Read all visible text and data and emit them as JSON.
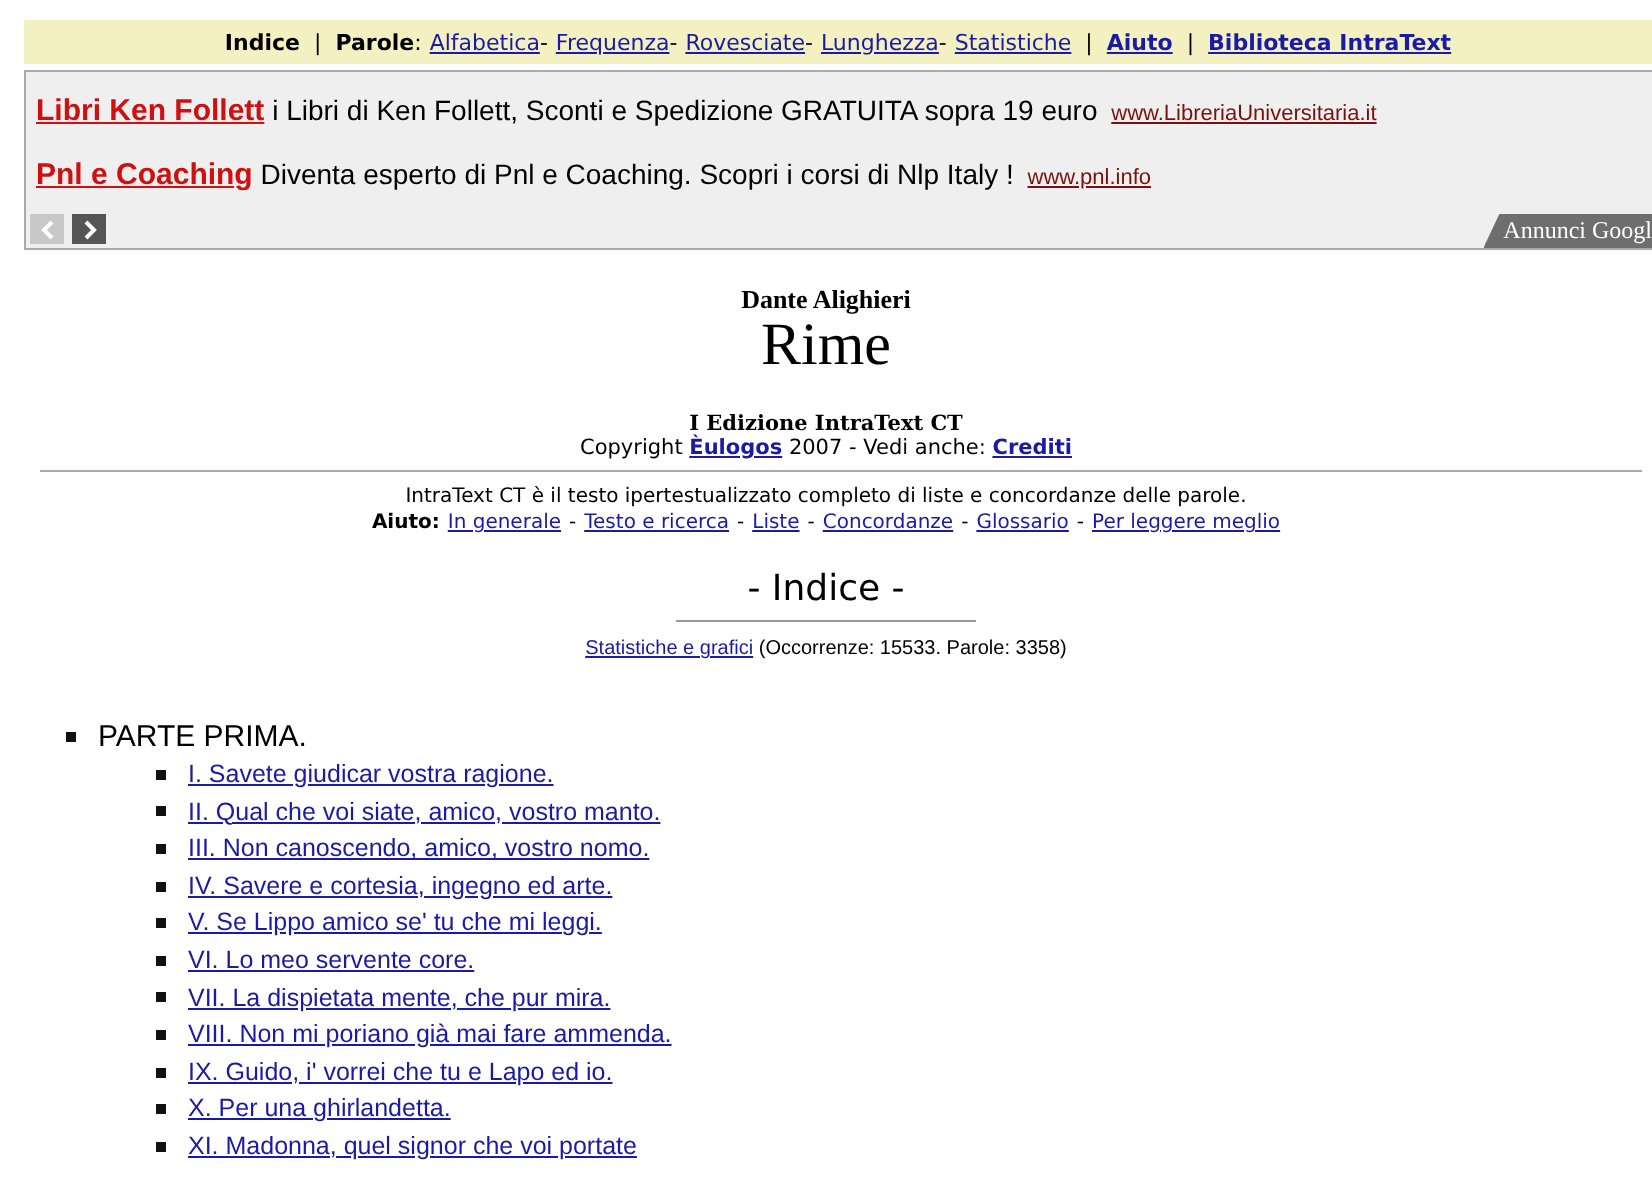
{
  "nav": {
    "items": [
      {
        "kind": "bold",
        "text": "Indice"
      },
      {
        "kind": "sep",
        "text": "|"
      },
      {
        "kind": "bold",
        "text": "Parole"
      },
      {
        "kind": "plain",
        "text": ":"
      },
      {
        "kind": "link",
        "text": "Alfabetica"
      },
      {
        "kind": "plain",
        "text": "-"
      },
      {
        "kind": "link",
        "text": "Frequenza"
      },
      {
        "kind": "plain",
        "text": "-"
      },
      {
        "kind": "link",
        "text": "Rovesciate"
      },
      {
        "kind": "plain",
        "text": "-"
      },
      {
        "kind": "link",
        "text": "Lunghezza"
      },
      {
        "kind": "plain",
        "text": "-"
      },
      {
        "kind": "link",
        "text": "Statistiche"
      },
      {
        "kind": "sep",
        "text": "|"
      },
      {
        "kind": "boldlink",
        "text": "Aiuto"
      },
      {
        "kind": "sep",
        "text": "|"
      },
      {
        "kind": "boldlink",
        "text": "Biblioteca IntraText"
      }
    ]
  },
  "ads": {
    "items": [
      {
        "title": "Libri Ken Follett",
        "text": "i Libri di Ken Follett, Sconti e Spedizione GRATUITA sopra 19 euro",
        "url": "www.LibreriaUniversitaria.it"
      },
      {
        "title": "Pnl e Coaching",
        "text": "Diventa esperto di Pnl e Coaching. Scopri i corsi di Nlp Italy !",
        "url": "www.pnl.info"
      }
    ],
    "prev_disabled": true,
    "next_disabled": false,
    "badge": "Annunci Googl"
  },
  "header": {
    "author": "Dante Alighieri",
    "title": "Rime",
    "edition": "I Edizione IntraText CT",
    "copyright": "Copyright",
    "publisher": "Èulogos",
    "year": "2007 - Vedi anche:",
    "credits": "Crediti"
  },
  "intro": {
    "text": "IntraText CT è il testo ipertestualizzato completo di liste e concordanze delle parole.",
    "help_label": "Aiuto:",
    "help_items": [
      {
        "kind": "link",
        "text": "In generale"
      },
      {
        "kind": "sep",
        "text": "-"
      },
      {
        "kind": "link",
        "text": "Testo e ricerca"
      },
      {
        "kind": "sep",
        "text": "-"
      },
      {
        "kind": "link",
        "text": "Liste"
      },
      {
        "kind": "sep",
        "text": "-"
      },
      {
        "kind": "link",
        "text": "Concordanze"
      },
      {
        "kind": "sep",
        "text": "-"
      },
      {
        "kind": "link",
        "text": "Glossario"
      },
      {
        "kind": "sep",
        "text": "-"
      },
      {
        "kind": "link",
        "text": "Per leggere meglio"
      }
    ]
  },
  "index": {
    "heading": "- Indice -",
    "stats_link": "Statistiche e grafici",
    "stats_text": "(Occorrenze: 15533. Parole: 3358)"
  },
  "toc": [
    {
      "label": "PARTE PRIMA.",
      "children": [
        {
          "label": "I. Savete giudicar vostra ragione."
        },
        {
          "label": "II. Qual che voi siate, amico, vostro manto."
        },
        {
          "label": "III. Non canoscendo, amico, vostro nomo."
        },
        {
          "label": "IV. Savere e cortesia, ingegno ed arte."
        },
        {
          "label": "V. Se Lippo amico se' tu che mi leggi."
        },
        {
          "label": "VI. Lo meo servente core."
        },
        {
          "label": "VII. La dispietata mente, che pur mira."
        },
        {
          "label": "VIII. Non mi poriano già mai fare ammenda."
        },
        {
          "label": "IX. Guido, i' vorrei che tu e Lapo ed io."
        },
        {
          "label": "X. Per una ghirlandetta."
        },
        {
          "label": "XI. Madonna, quel signor che voi portate"
        }
      ]
    }
  ]
}
